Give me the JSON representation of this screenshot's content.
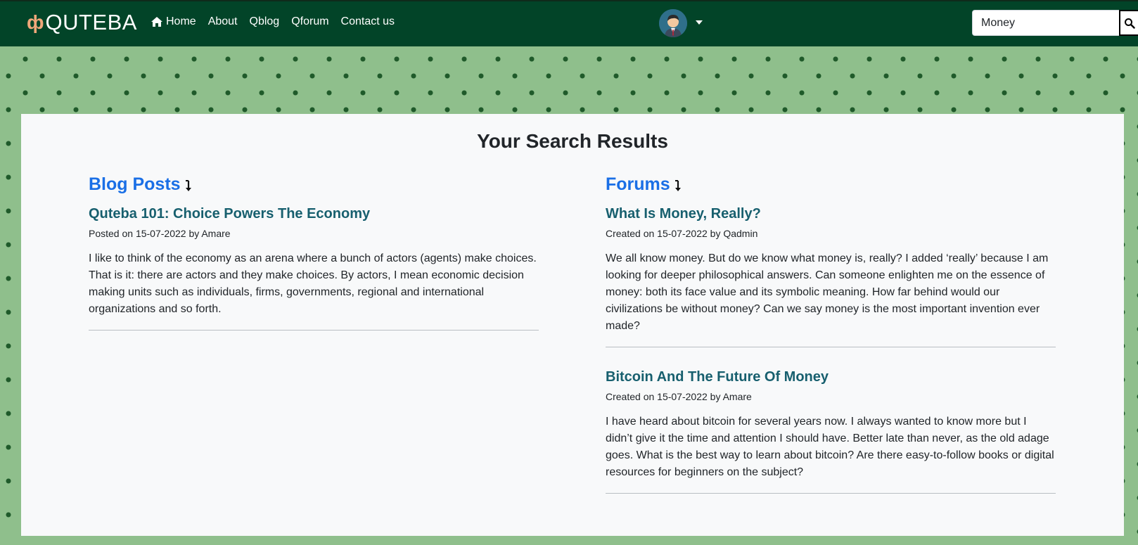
{
  "brand": {
    "name": "QUTEBA"
  },
  "nav": {
    "home": "Home",
    "about": "About",
    "qblog": "Qblog",
    "qforum": "Qforum",
    "contact": "Contact us"
  },
  "search": {
    "value": "Money"
  },
  "page": {
    "title": "Your Search Results"
  },
  "blog": {
    "heading": "Blog Posts",
    "posts": [
      {
        "title": "Quteba 101: Choice Powers The Economy",
        "meta": "Posted on 15-07-2022 by Amare",
        "excerpt": "I like to think of the economy as an arena where a bunch of actors (agents) make choices. That is it: there are actors and they make choices. By actors, I mean economic decision making units such as individuals, firms, governments, regional and international organizations and so forth."
      }
    ]
  },
  "forums": {
    "heading": "Forums",
    "items": [
      {
        "title": "What Is Money, Really?",
        "meta": "Created on 15-07-2022 by Qadmin",
        "excerpt": "We all know money. But do we know what money is, really? I added ‘really’ because I am looking for deeper philosophical answers. Can someone enlighten me on the essence of money: both its face value and its symbolic meaning. How far behind would our civilizations be without money? Can we say money is the most important invention ever made?"
      },
      {
        "title": "Bitcoin And The Future Of Money",
        "meta": "Created on 15-07-2022 by Amare",
        "excerpt": "I have heard about bitcoin for several years now. I always wanted to know more but I didn’t give it the time and attention I should have. Better late than never, as the old adage goes. What is the best way to learn about bitcoin? Are there easy-to-follow books or digital resources for beginners on the subject?"
      }
    ]
  },
  "colors": {
    "navbar": "#024428",
    "heading": "#1a6fe6",
    "entry_title": "#175f6e",
    "background_pattern": "#8fbf8c"
  },
  "icons": {
    "home": "home-icon",
    "search": "search-icon",
    "sort": "arrow-down-icon",
    "avatar": "user-avatar",
    "dropdown": "caret-down-icon"
  }
}
